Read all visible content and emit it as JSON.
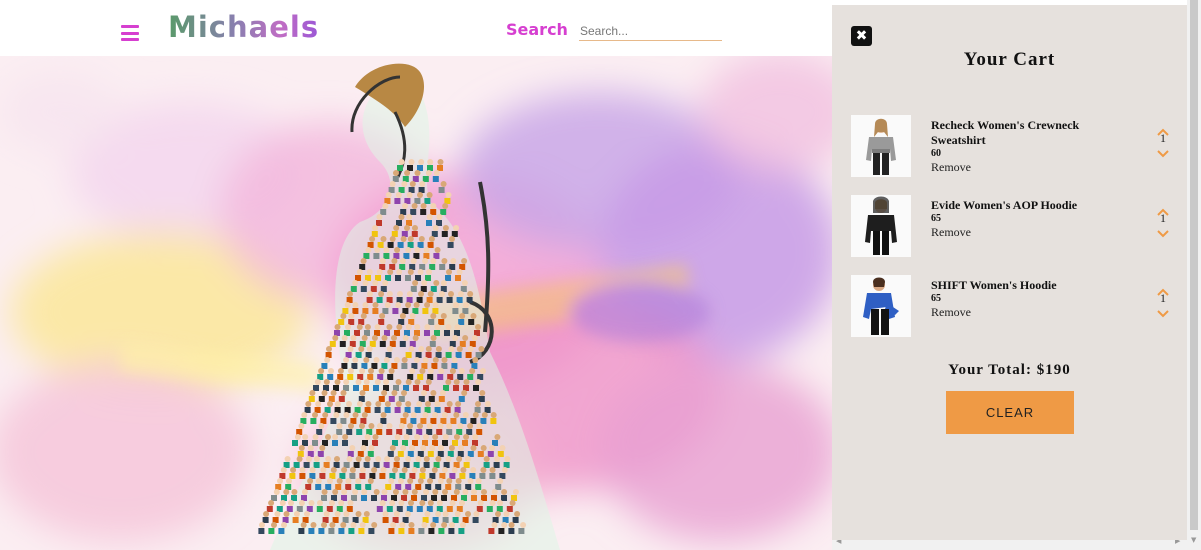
{
  "header": {
    "logo": "Michaels",
    "search_label": "Search",
    "search_placeholder": "Search...",
    "search_value": ""
  },
  "icons": {
    "menu": "hamburger-icon",
    "close": "close-x-icon",
    "qty_up": "chevron-up-icon",
    "qty_down": "chevron-down-icon"
  },
  "colors": {
    "accent": "#d63fd0",
    "cart_bg": "#e6e1dd",
    "clear_button": "#ef9a45",
    "chevron": "#ef9a45"
  },
  "cart": {
    "title": "Your Cart",
    "items": [
      {
        "name": "Recheck Women's Crewneck Sweatshirt",
        "price": "60",
        "remove_label": "Remove",
        "quantity": "1"
      },
      {
        "name": "Evide Women's AOP Hoodie",
        "price": "65",
        "remove_label": "Remove",
        "quantity": "1"
      },
      {
        "name": "SHIFT Women's Hoodie",
        "price": "65",
        "remove_label": "Remove",
        "quantity": "1"
      }
    ],
    "total_label": "Your Total: $190",
    "clear_label": "CLEAR"
  }
}
